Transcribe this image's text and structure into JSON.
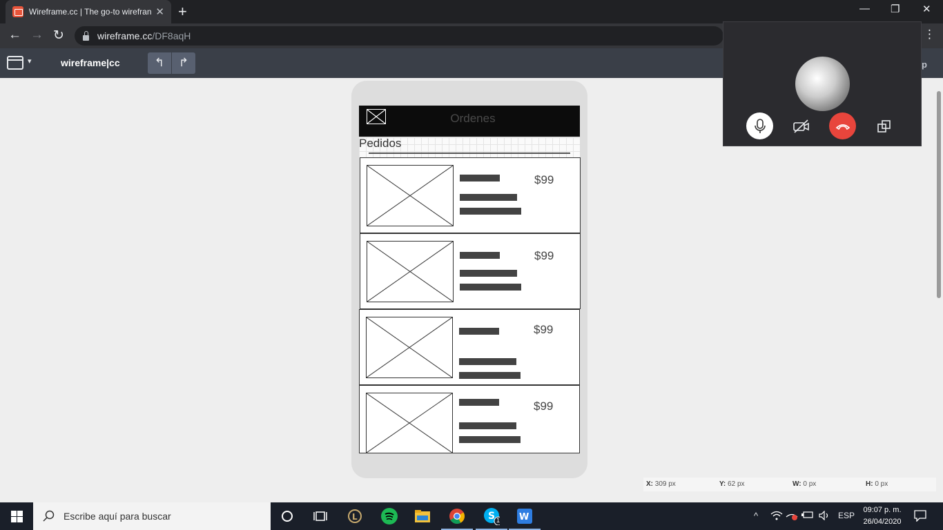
{
  "browser": {
    "tab_title": "Wireframe.cc | The go-to wirefran",
    "tab_close": "✕",
    "new_tab": "+",
    "url_host": "wireframe.cc",
    "url_path": "/DF8aqH",
    "window_controls": [
      "—",
      "❐",
      "✕"
    ],
    "menu": "⋮"
  },
  "app": {
    "brand": "wireframe|cc",
    "undo": "↰",
    "redo": "↱",
    "help_partial": "p"
  },
  "wireframe": {
    "header_title": "Ordenes",
    "section_label": "Pedidos",
    "cards": [
      {
        "price": "$99"
      },
      {
        "price": "$99"
      },
      {
        "price": "$99"
      },
      {
        "price": "$99"
      }
    ]
  },
  "readout": {
    "x_label": "X:",
    "x_value": "309 px",
    "y_label": "Y:",
    "y_value": "62 px",
    "w_label": "W:",
    "w_value": "0 px",
    "h_label": "H:",
    "h_value": "0 px"
  },
  "call": {
    "buttons": [
      "microphone-icon",
      "camera-off-icon",
      "hang-up-icon",
      "popout-icon"
    ],
    "end_color": "#e8453c"
  },
  "taskbar": {
    "search_placeholder": "Escribe aquí para buscar",
    "skype_badge": "1",
    "language": "ESP",
    "time": "09:07 p. m.",
    "date": "26/04/2020"
  },
  "colors": {
    "header_bg": "#0c0c0c",
    "placeholder_bar": "#434343",
    "appbar_bg": "#3a3f48"
  }
}
